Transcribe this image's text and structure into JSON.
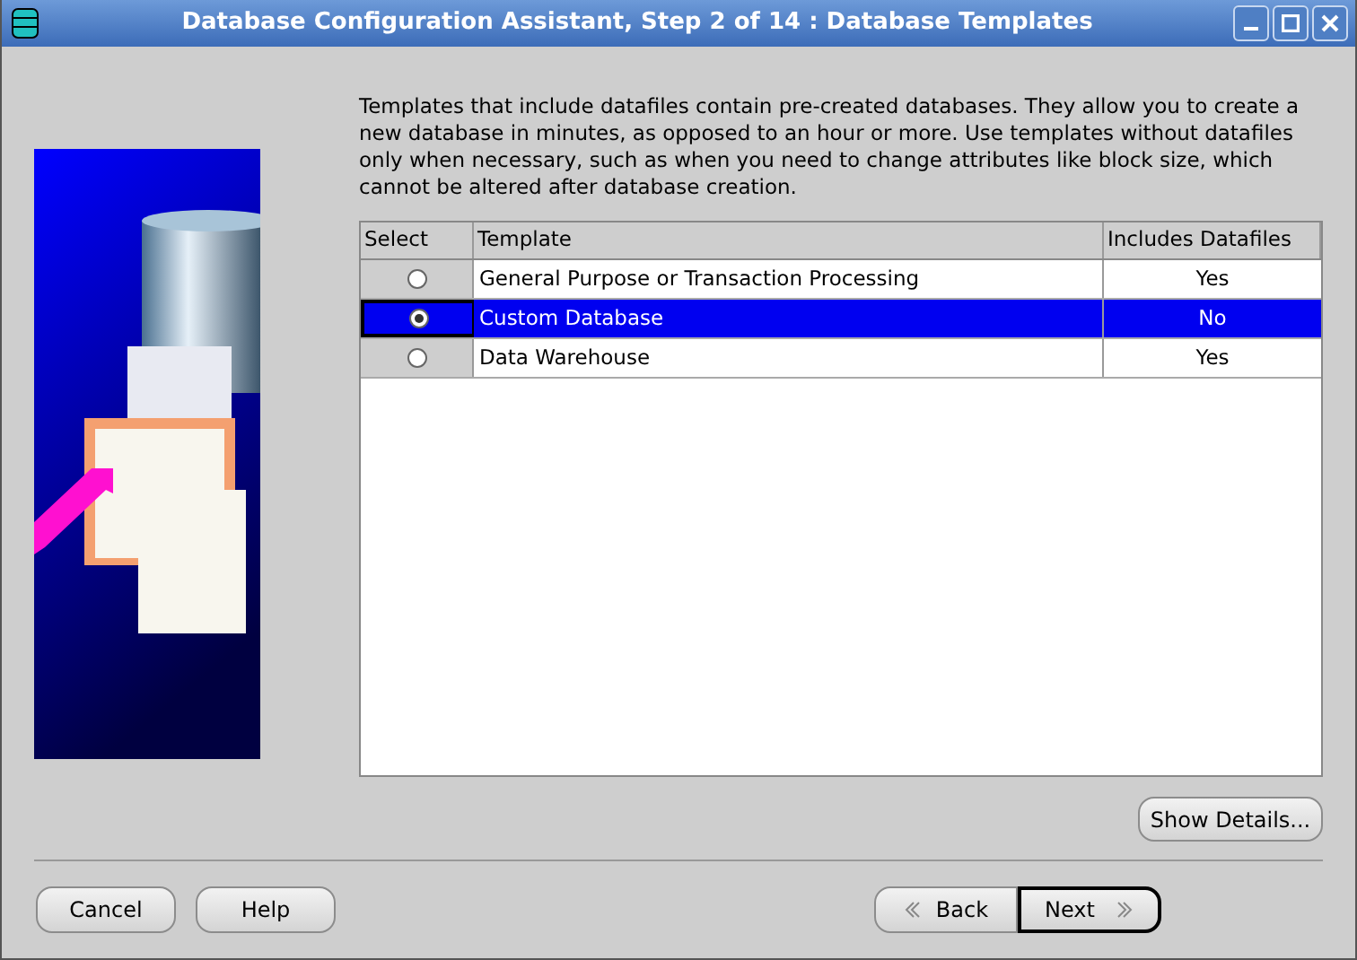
{
  "window": {
    "title": "Database Configuration Assistant, Step 2 of 14 : Database Templates"
  },
  "description": "Templates that include datafiles contain pre-created databases. They allow you to create a new database in minutes, as opposed to an hour or more. Use templates without datafiles only when necessary, such as when you need to change attributes like block size, which cannot be altered after database creation.",
  "table": {
    "columns": [
      "Select",
      "Template",
      "Includes Datafiles"
    ],
    "rows": [
      {
        "template": "General Purpose or Transaction Processing",
        "includes_datafiles": "Yes",
        "selected": false
      },
      {
        "template": "Custom Database",
        "includes_datafiles": "No",
        "selected": true
      },
      {
        "template": "Data Warehouse",
        "includes_datafiles": "Yes",
        "selected": false
      }
    ]
  },
  "show_details_button": "Show Details...",
  "buttons": {
    "cancel": "Cancel",
    "help": "Help",
    "back": "Back",
    "next": "Next"
  }
}
